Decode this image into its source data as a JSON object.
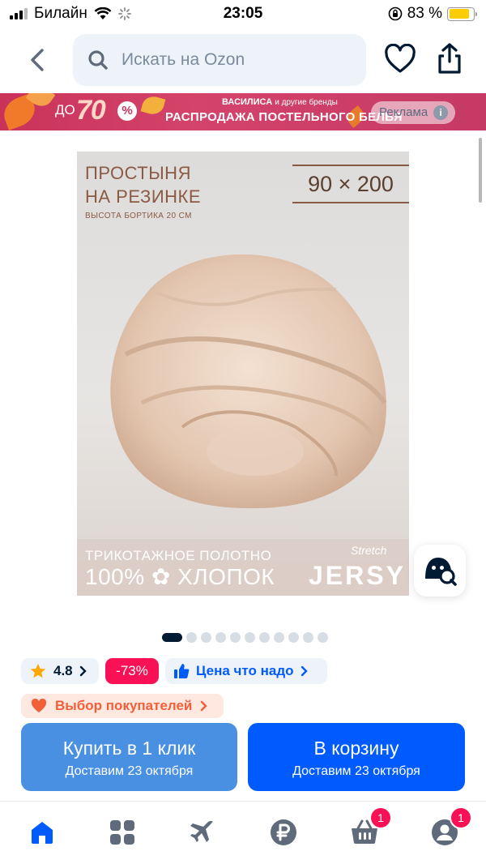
{
  "status_bar": {
    "carrier": "Билайн",
    "time": "23:05",
    "battery": "83 %",
    "battery_level": 0.83
  },
  "header": {
    "search_placeholder": "Искать на Ozon"
  },
  "banner": {
    "prefix": "ДО",
    "discount": "70",
    "percent_sign": "%",
    "brand": "ВАСИЛИСА",
    "brand_suffix": "и другие бренды",
    "headline": "РАСПРОДАЖА ПОСТЕЛЬНОГО БЕЛЬЯ",
    "ad_label": "Реклама",
    "ad_info": "i"
  },
  "product_image": {
    "title_line1": "ПРОСТЫНЯ",
    "title_line2": "НА РЕЗИНКЕ",
    "subtitle": "ВЫСОТА БОРТИКА 20 СМ",
    "size": "90 × 200",
    "fabric": "ТРИКОТАЖНОЕ ПОЛОТНО",
    "cotton": "100% ✿ ХЛОПОК",
    "brand_mark": "JERSY",
    "script_mark": "Stretch"
  },
  "gallery": {
    "total": 11,
    "active_index": 0
  },
  "chips": {
    "rating": "4.8",
    "discount": "-73%",
    "price_label": "Цена что надо",
    "choice_label": "Выбор покупателей"
  },
  "buttons": {
    "quick_buy": {
      "title": "Купить в 1 клик",
      "subtitle": "Доставим 23 октября"
    },
    "add_to_cart": {
      "title": "В корзину",
      "subtitle": "Доставим 23 октября"
    }
  },
  "nav": {
    "items": [
      "home-icon",
      "catalog-icon",
      "travel-icon",
      "finance-icon",
      "cart-icon",
      "profile-icon"
    ],
    "cart_badge": "1",
    "profile_badge": "1"
  },
  "colors": {
    "brand_blue": "#005bff",
    "discount_pink": "#f91155",
    "quick_buy_blue": "#4a90e2"
  }
}
